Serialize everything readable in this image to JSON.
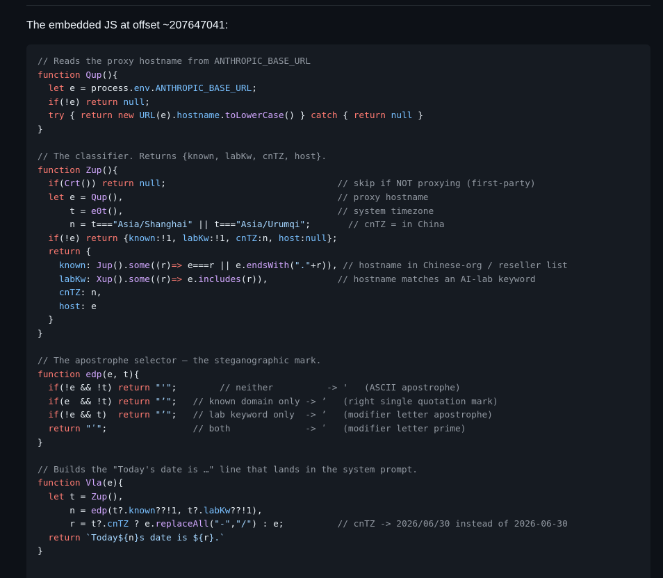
{
  "heading": "The embedded JS at offset ~207647041:",
  "colors": {
    "background": "#0d1117",
    "code_background": "#161b22",
    "plain": "#e6edf3",
    "comment": "#9198a1",
    "keyword": "#ff7b72",
    "function": "#d2a8ff",
    "property": "#79c0ff",
    "constant": "#79c0ff",
    "string": "#a5d6ff"
  },
  "code_lines": [
    [
      [
        "comment",
        "// Reads the proxy hostname from ANTHROPIC_BASE_URL"
      ]
    ],
    [
      [
        "keyword",
        "function"
      ],
      [
        "plain",
        " "
      ],
      [
        "function",
        "Qup"
      ],
      [
        "plain",
        "(){"
      ]
    ],
    [
      [
        "plain",
        "  "
      ],
      [
        "keyword",
        "let"
      ],
      [
        "plain",
        " e = process."
      ],
      [
        "property",
        "env"
      ],
      [
        "plain",
        "."
      ],
      [
        "constant",
        "ANTHROPIC_BASE_URL"
      ],
      [
        "plain",
        ";"
      ]
    ],
    [
      [
        "plain",
        "  "
      ],
      [
        "keyword",
        "if"
      ],
      [
        "plain",
        "(!e) "
      ],
      [
        "keyword",
        "return"
      ],
      [
        "plain",
        " "
      ],
      [
        "constant",
        "null"
      ],
      [
        "plain",
        ";"
      ]
    ],
    [
      [
        "plain",
        "  "
      ],
      [
        "keyword",
        "try"
      ],
      [
        "plain",
        " { "
      ],
      [
        "keyword",
        "return"
      ],
      [
        "plain",
        " "
      ],
      [
        "keyword",
        "new"
      ],
      [
        "plain",
        " "
      ],
      [
        "constant",
        "URL"
      ],
      [
        "plain",
        "(e)."
      ],
      [
        "property",
        "hostname"
      ],
      [
        "plain",
        "."
      ],
      [
        "function",
        "toLowerCase"
      ],
      [
        "plain",
        "() } "
      ],
      [
        "keyword",
        "catch"
      ],
      [
        "plain",
        " { "
      ],
      [
        "keyword",
        "return"
      ],
      [
        "plain",
        " "
      ],
      [
        "constant",
        "null"
      ],
      [
        "plain",
        " }"
      ]
    ],
    [
      [
        "plain",
        "}"
      ]
    ],
    [
      [
        "plain",
        ""
      ]
    ],
    [
      [
        "comment",
        "// The classifier. Returns {known, labKw, cnTZ, host}."
      ]
    ],
    [
      [
        "keyword",
        "function"
      ],
      [
        "plain",
        " "
      ],
      [
        "function",
        "Zup"
      ],
      [
        "plain",
        "(){"
      ]
    ],
    [
      [
        "plain",
        "  "
      ],
      [
        "keyword",
        "if"
      ],
      [
        "plain",
        "("
      ],
      [
        "function",
        "Crt"
      ],
      [
        "plain",
        "()) "
      ],
      [
        "keyword",
        "return"
      ],
      [
        "plain",
        " "
      ],
      [
        "constant",
        "null"
      ],
      [
        "plain",
        ";                                "
      ],
      [
        "comment",
        "// skip if NOT proxying (first-party)"
      ]
    ],
    [
      [
        "plain",
        "  "
      ],
      [
        "keyword",
        "let"
      ],
      [
        "plain",
        " e = "
      ],
      [
        "function",
        "Qup"
      ],
      [
        "plain",
        "(),                                        "
      ],
      [
        "comment",
        "// proxy hostname"
      ]
    ],
    [
      [
        "plain",
        "      t = "
      ],
      [
        "function",
        "e0t"
      ],
      [
        "plain",
        "(),                                        "
      ],
      [
        "comment",
        "// system timezone"
      ]
    ],
    [
      [
        "plain",
        "      n = t==="
      ],
      [
        "string",
        "\"Asia/Shanghai\""
      ],
      [
        "plain",
        " || t==="
      ],
      [
        "string",
        "\"Asia/Urumqi\""
      ],
      [
        "plain",
        ";       "
      ],
      [
        "comment",
        "// cnTZ = in China"
      ]
    ],
    [
      [
        "plain",
        "  "
      ],
      [
        "keyword",
        "if"
      ],
      [
        "plain",
        "(!e) "
      ],
      [
        "keyword",
        "return"
      ],
      [
        "plain",
        " {"
      ],
      [
        "property",
        "known"
      ],
      [
        "plain",
        ":!1, "
      ],
      [
        "property",
        "labKw"
      ],
      [
        "plain",
        ":!1, "
      ],
      [
        "property",
        "cnTZ"
      ],
      [
        "plain",
        ":n, "
      ],
      [
        "property",
        "host"
      ],
      [
        "plain",
        ":"
      ],
      [
        "constant",
        "null"
      ],
      [
        "plain",
        "};"
      ]
    ],
    [
      [
        "plain",
        "  "
      ],
      [
        "keyword",
        "return"
      ],
      [
        "plain",
        " {"
      ]
    ],
    [
      [
        "plain",
        "    "
      ],
      [
        "property",
        "known"
      ],
      [
        "plain",
        ": "
      ],
      [
        "function",
        "Jup"
      ],
      [
        "plain",
        "()."
      ],
      [
        "function",
        "some"
      ],
      [
        "plain",
        "((r)"
      ],
      [
        "keyword",
        "=>"
      ],
      [
        "plain",
        " e===r || e."
      ],
      [
        "function",
        "endsWith"
      ],
      [
        "plain",
        "("
      ],
      [
        "string",
        "\".\""
      ],
      [
        "plain",
        "+r)), "
      ],
      [
        "comment",
        "// hostname in Chinese-org / reseller list"
      ]
    ],
    [
      [
        "plain",
        "    "
      ],
      [
        "property",
        "labKw"
      ],
      [
        "plain",
        ": "
      ],
      [
        "function",
        "Xup"
      ],
      [
        "plain",
        "()."
      ],
      [
        "function",
        "some"
      ],
      [
        "plain",
        "((r)"
      ],
      [
        "keyword",
        "=>"
      ],
      [
        "plain",
        " e."
      ],
      [
        "function",
        "includes"
      ],
      [
        "plain",
        "(r)),             "
      ],
      [
        "comment",
        "// hostname matches an AI-lab keyword"
      ]
    ],
    [
      [
        "plain",
        "    "
      ],
      [
        "property",
        "cnTZ"
      ],
      [
        "plain",
        ": n,"
      ]
    ],
    [
      [
        "plain",
        "    "
      ],
      [
        "property",
        "host"
      ],
      [
        "plain",
        ": e"
      ]
    ],
    [
      [
        "plain",
        "  }"
      ]
    ],
    [
      [
        "plain",
        "}"
      ]
    ],
    [
      [
        "plain",
        ""
      ]
    ],
    [
      [
        "comment",
        "// The apostrophe selector — the steganographic mark."
      ]
    ],
    [
      [
        "keyword",
        "function"
      ],
      [
        "plain",
        " "
      ],
      [
        "function",
        "edp"
      ],
      [
        "plain",
        "(e, t){"
      ]
    ],
    [
      [
        "plain",
        "  "
      ],
      [
        "keyword",
        "if"
      ],
      [
        "plain",
        "(!e && !t) "
      ],
      [
        "keyword",
        "return"
      ],
      [
        "plain",
        " "
      ],
      [
        "string",
        "\"'\""
      ],
      [
        "plain",
        ";        "
      ],
      [
        "comment",
        "// neither          -> '   (ASCII apostrophe)"
      ]
    ],
    [
      [
        "plain",
        "  "
      ],
      [
        "keyword",
        "if"
      ],
      [
        "plain",
        "(e  && !t) "
      ],
      [
        "keyword",
        "return"
      ],
      [
        "plain",
        " "
      ],
      [
        "string",
        "\"’\""
      ],
      [
        "plain",
        ";   "
      ],
      [
        "comment",
        "// known domain only -> ’   (right single quotation mark)"
      ]
    ],
    [
      [
        "plain",
        "  "
      ],
      [
        "keyword",
        "if"
      ],
      [
        "plain",
        "(!e && t)  "
      ],
      [
        "keyword",
        "return"
      ],
      [
        "plain",
        " "
      ],
      [
        "string",
        "\"ʼ\""
      ],
      [
        "plain",
        ";   "
      ],
      [
        "comment",
        "// lab keyword only  -> ʼ   (modifier letter apostrophe)"
      ]
    ],
    [
      [
        "plain",
        "  "
      ],
      [
        "keyword",
        "return"
      ],
      [
        "plain",
        " "
      ],
      [
        "string",
        "\"ʹ\""
      ],
      [
        "plain",
        ";                "
      ],
      [
        "comment",
        "// both              -> ʹ   (modifier letter prime)"
      ]
    ],
    [
      [
        "plain",
        "}"
      ]
    ],
    [
      [
        "plain",
        ""
      ]
    ],
    [
      [
        "comment",
        "// Builds the \"Today's date is …\" line that lands in the system prompt."
      ]
    ],
    [
      [
        "keyword",
        "function"
      ],
      [
        "plain",
        " "
      ],
      [
        "function",
        "Vla"
      ],
      [
        "plain",
        "(e){"
      ]
    ],
    [
      [
        "plain",
        "  "
      ],
      [
        "keyword",
        "let"
      ],
      [
        "plain",
        " t = "
      ],
      [
        "function",
        "Zup"
      ],
      [
        "plain",
        "(),"
      ]
    ],
    [
      [
        "plain",
        "      n = "
      ],
      [
        "function",
        "edp"
      ],
      [
        "plain",
        "(t?."
      ],
      [
        "property",
        "known"
      ],
      [
        "plain",
        "??!1, t?."
      ],
      [
        "property",
        "labKw"
      ],
      [
        "plain",
        "??!1),"
      ]
    ],
    [
      [
        "plain",
        "      r = t?."
      ],
      [
        "property",
        "cnTZ"
      ],
      [
        "plain",
        " ? e."
      ],
      [
        "function",
        "replaceAll"
      ],
      [
        "plain",
        "("
      ],
      [
        "string",
        "\"-\""
      ],
      [
        "plain",
        ","
      ],
      [
        "string",
        "\"/\""
      ],
      [
        "plain",
        ") : e;          "
      ],
      [
        "comment",
        "// cnTZ -> 2026/06/30 instead of 2026-06-30"
      ]
    ],
    [
      [
        "plain",
        "  "
      ],
      [
        "keyword",
        "return"
      ],
      [
        "plain",
        " "
      ],
      [
        "string",
        "`Today${"
      ],
      [
        "plain",
        "n"
      ],
      [
        "string",
        "}s date is ${"
      ],
      [
        "plain",
        "r"
      ],
      [
        "string",
        "}.`"
      ]
    ],
    [
      [
        "plain",
        "}"
      ]
    ]
  ]
}
